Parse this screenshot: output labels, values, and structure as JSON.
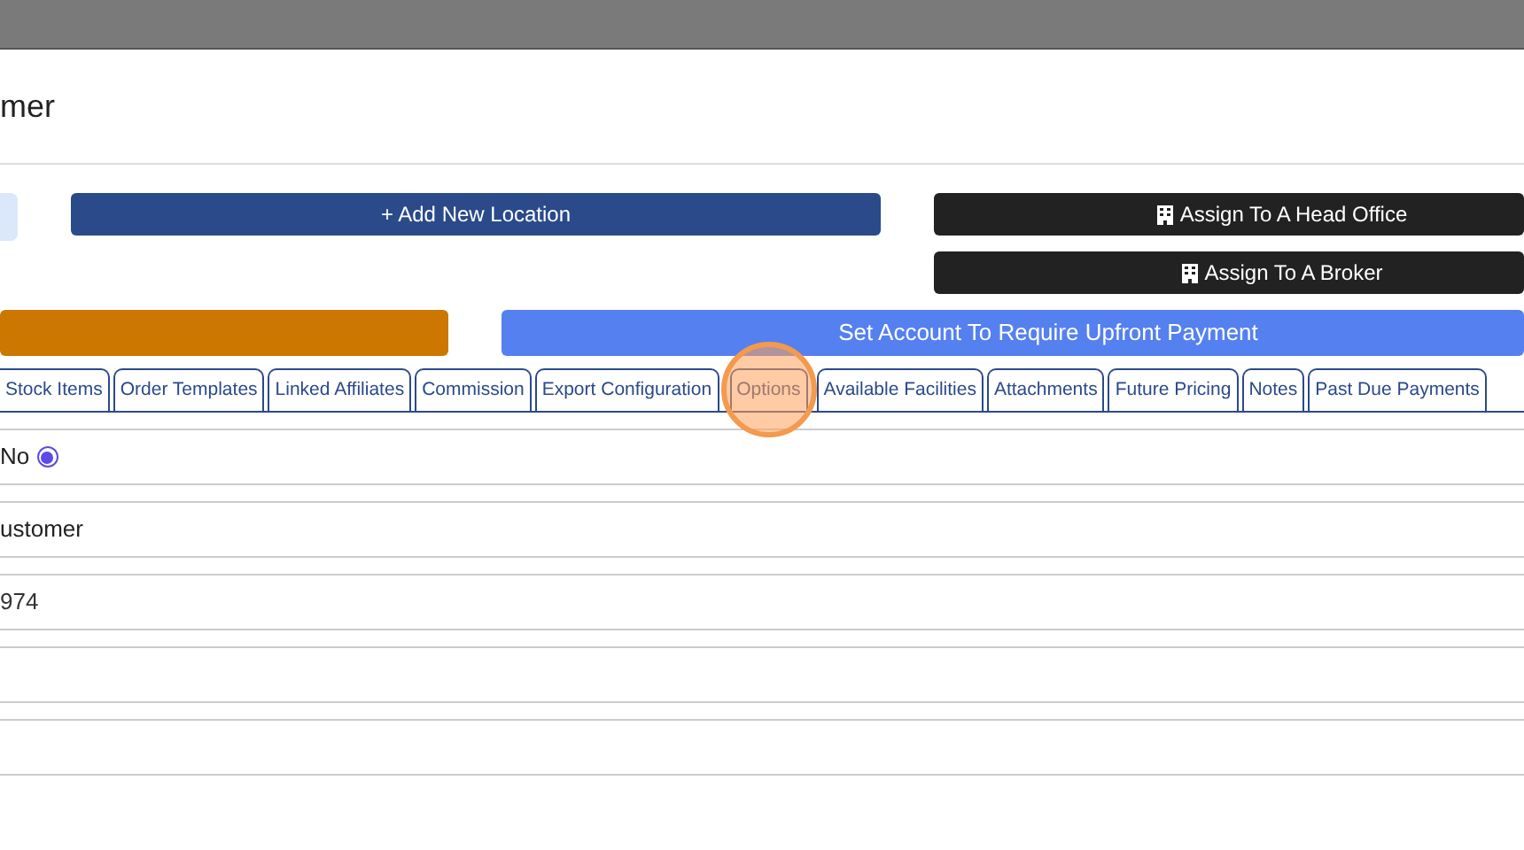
{
  "modal": {
    "title": "mer"
  },
  "action_rows": [
    {
      "buttons": [
        {
          "kind": "light"
        },
        {
          "kind": "navy",
          "label": "+ Add New Location"
        },
        {
          "kind": "dark",
          "label": "Assign To A Head Office"
        }
      ]
    },
    {
      "buttons": [
        {
          "kind": "spacer"
        },
        {
          "kind": "spacer"
        },
        {
          "kind": "dark",
          "label": "Assign To A Broker"
        }
      ]
    },
    {
      "buttons": [
        {
          "kind": "orange"
        },
        {
          "kind": "blue",
          "label": "Set Account To Require Upfront Payment"
        }
      ]
    }
  ],
  "tabs": [
    {
      "label": "Stock Items",
      "selected": false,
      "highlighted": false
    },
    {
      "label": "Order Templates",
      "selected": false,
      "highlighted": false
    },
    {
      "label": "Linked Affiliates",
      "selected": false,
      "highlighted": false
    },
    {
      "label": "Commission",
      "selected": false,
      "highlighted": false
    },
    {
      "label": "Export Configuration",
      "selected": false,
      "highlighted": false
    },
    {
      "label": "Options",
      "selected": false,
      "highlighted": true
    },
    {
      "label": "Available Facilities",
      "selected": false,
      "highlighted": false
    },
    {
      "label": "Attachments",
      "selected": false,
      "highlighted": false
    },
    {
      "label": "Future Pricing",
      "selected": false,
      "highlighted": false
    },
    {
      "label": "Notes",
      "selected": false,
      "highlighted": false
    },
    {
      "label": "Past Due Payments",
      "selected": false,
      "highlighted": false
    }
  ],
  "rows": [
    {
      "kind": "radio",
      "label": "No",
      "checked": true
    },
    {
      "kind": "text",
      "value": "ustomer"
    },
    {
      "kind": "input",
      "value": "974"
    },
    {
      "kind": "empty"
    },
    {
      "kind": "empty"
    }
  ]
}
